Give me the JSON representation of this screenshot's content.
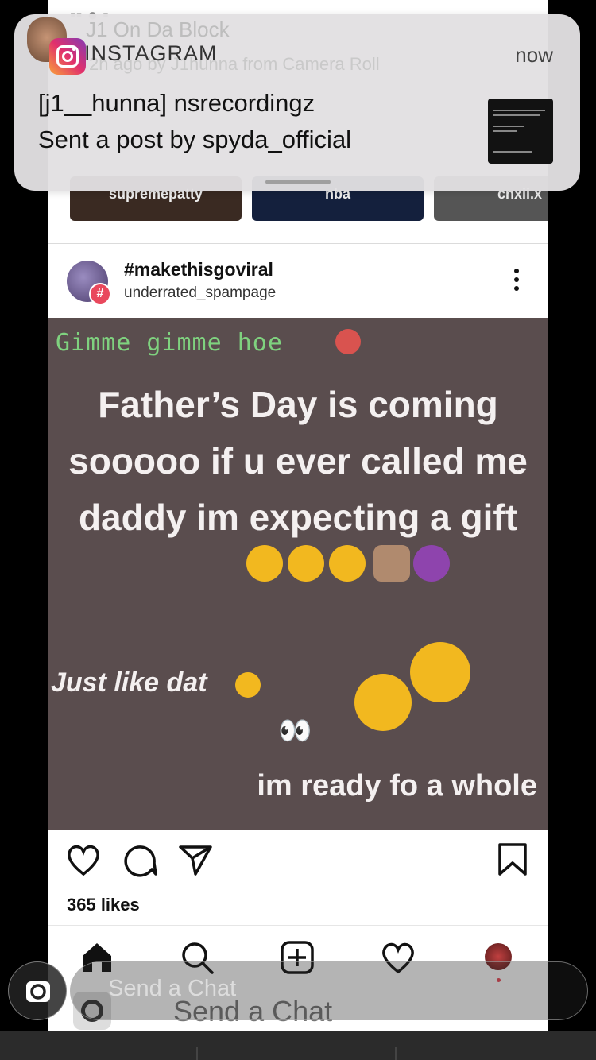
{
  "notification": {
    "app_name": "INSTAGRAM",
    "time": "now",
    "title": "[j1__hunna] nsrecordingz",
    "body": "Sent a post by spyda_official",
    "ghost_title": "J1 On Da Block",
    "ghost_subtitle": "2h ago by J1hunna from Camera Roll"
  },
  "stories": [
    "supremepatty",
    "nba",
    "cnxii.x"
  ],
  "post": {
    "title": "#makethisgoviral",
    "subtitle": "underrated_spampage",
    "image_text": {
      "top": "Gimme gimme hoe",
      "main": "Father’s Day is coming sooooo if u ever called me daddy im expecting a gift",
      "just_like": "Just like dat",
      "eyes": "👀",
      "ready": "im ready fo a whole"
    },
    "likes": "365 likes"
  },
  "chat": {
    "placeholder": "Send a Chat",
    "ghost_placeholder": "Send a Chat"
  },
  "icons": {
    "like": "heart-icon",
    "comment": "comment-icon",
    "share": "send-icon",
    "save": "bookmark-icon",
    "home": "home-icon",
    "search": "search-icon",
    "add": "add-post-icon",
    "activity": "heart-icon",
    "camera": "camera-icon"
  },
  "colors": {
    "post_background": "#5a4d4e",
    "gimme_green": "#7fd27f",
    "notification_bg": "#e2e0e2",
    "instagram_pink": "#e1306c"
  }
}
